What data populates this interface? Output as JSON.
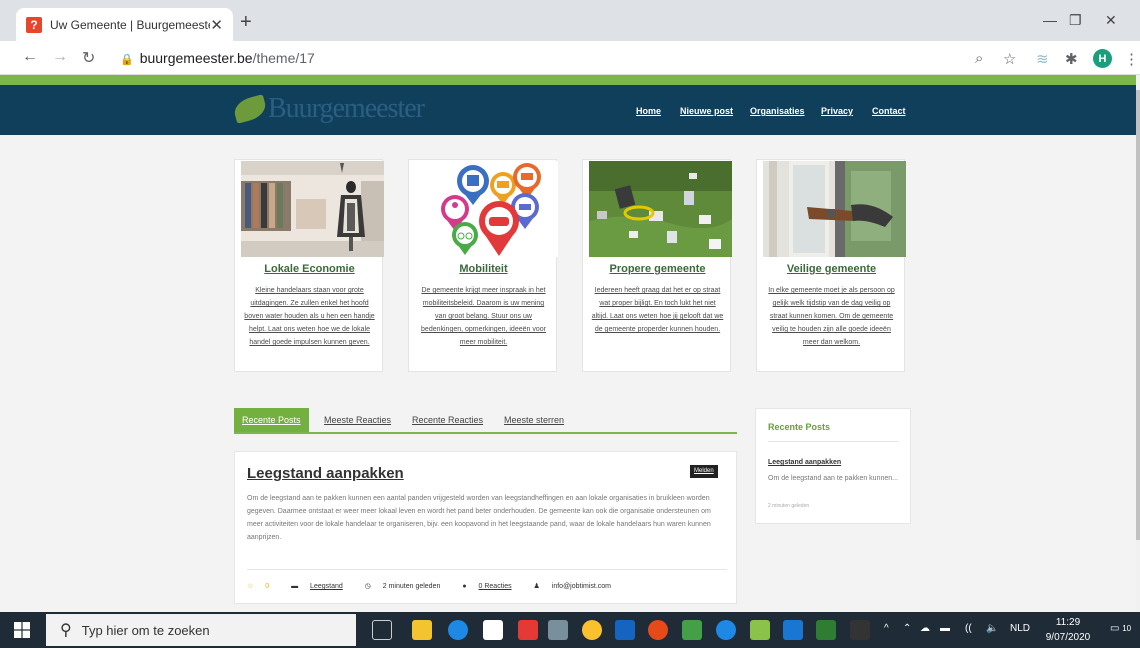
{
  "browser": {
    "tab_title": "Uw Gemeente | Buurgemeester",
    "new_tab": "+",
    "url_host": "buurgemeester.be",
    "url_path": "/theme/17",
    "profile_initial": "H"
  },
  "site": {
    "logo": "Buurgemeester",
    "nav": [
      "Home",
      "Nieuwe post",
      "Organisaties",
      "Privacy",
      "Contact"
    ],
    "cards": [
      {
        "title": "Lokale Economie",
        "text": "Kleine handelaars staan voor grote uitdagingen. Ze zullen enkel het hoofd boven water houden als u hen een handje helpt. Laat ons weten hoe we de lokale handel goede impulsen kunnen geven."
      },
      {
        "title": "Mobiliteit",
        "text": "De gemeente krijgt meer inspraak in het mobiliteitsbeleid. Daarom is uw mening van groot belang. Stuur ons uw bedenkingen, opmerkingen, ideeën voor meer mobiliteit."
      },
      {
        "title": "Propere gemeente",
        "text": "Iedereen heeft graag dat het er op straat wat proper bijligt. En toch lukt het niet altijd. Laat ons weten hoe jij gelooft dat we de gemeente properder kunnen houden."
      },
      {
        "title": "Veilige gemeente",
        "text": "In elke gemeente moet je als persoon op gelijk welk tijdstip van de dag veilig op straat kunnen komen. Om de gemeente veilig te houden zijn alle goede ideeën meer dan welkom."
      }
    ],
    "tabs": [
      "Recente Posts",
      "Meeste Reacties",
      "Recente Reacties",
      "Meeste sterren"
    ],
    "post": {
      "title": "Leegstand aanpakken",
      "report_label": "Melden",
      "body": "Om de leegstand aan te pakken kunnen een aantal panden vrijgesteld worden van leegstandheffingen en aan lokale organisaties in bruikleen worden gegeven. Daarmee ontstaat er weer meer lokaal leven en wordt het pand beter onderhouden. De gemeente kan ook die organisatie ondersteunen om meer activiteiten voor de lokale handelaar te organiseren, bijv. een koopavond in het leegstaande pand, waar de lokale handelaars hun waren kunnen aanprijzen.",
      "stars": "0",
      "category": "Leegstand",
      "time": "2 minuten geleden",
      "reactions": "0 Reacties",
      "author": "info@jobtimist.com"
    },
    "widget": {
      "title": "Recente Posts",
      "post_title": "Leegstand aanpakken",
      "excerpt": "Om de leegstand aan te pakken kunnen...",
      "time": "2 minuten geleden"
    }
  },
  "taskbar": {
    "search_placeholder": "Typ hier om te zoeken",
    "language": "NLD",
    "time": "11:29",
    "date": "9/07/2020",
    "notifications": "10"
  }
}
